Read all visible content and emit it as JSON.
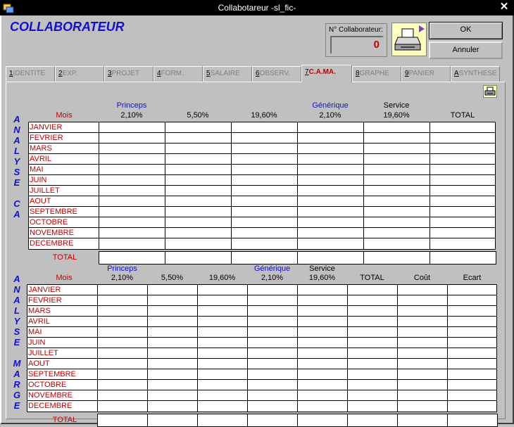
{
  "window": {
    "title": "Collabotareur -sl_fic-",
    "close_label": "✕"
  },
  "heading": "COLLABORATEUR",
  "collaborator": {
    "label": "N° Collaborateur:",
    "value": "0"
  },
  "buttons": {
    "ok": "OK",
    "cancel": "Annuler"
  },
  "tabs": [
    {
      "num": "1",
      "label": "IDENTITE"
    },
    {
      "num": "2",
      "label": "EXP."
    },
    {
      "num": "3",
      "label": "PROJET"
    },
    {
      "num": "4",
      "label": "FORM."
    },
    {
      "num": "5",
      "label": "SALAIRE"
    },
    {
      "num": "6",
      "label": "OBSERV."
    },
    {
      "num": "7",
      "label": "C.A.MA."
    },
    {
      "num": "8",
      "label": "GRAPHE"
    },
    {
      "num": "9",
      "label": "PANIER"
    },
    {
      "num": "A",
      "label": "SYNTHESE"
    }
  ],
  "active_tab": 6,
  "section1": {
    "vertical_label": [
      "A",
      "N",
      "A",
      "L",
      "Y",
      "S",
      "E",
      "",
      "C",
      "A"
    ],
    "month_header": "Mois",
    "columns": [
      {
        "top": "Princeps",
        "bottom": "2,10%"
      },
      {
        "top": "",
        "bottom": "5,50%"
      },
      {
        "top": "",
        "bottom": "19,60%"
      },
      {
        "top": "Générique",
        "bottom": "2,10%"
      },
      {
        "top": "Service",
        "bottom": "19,60%"
      },
      {
        "top": "",
        "bottom": "TOTAL"
      }
    ],
    "total_label": "TOTAL"
  },
  "section2": {
    "vertical_label": [
      "A",
      "N",
      "A",
      "L",
      "Y",
      "S",
      "E",
      "",
      "M",
      "A",
      "R",
      "G",
      "E"
    ],
    "month_header": "Mois",
    "columns": [
      {
        "top": "Princeps",
        "bottom": "2,10%"
      },
      {
        "top": "",
        "bottom": "5,50%"
      },
      {
        "top": "",
        "bottom": "19,60%"
      },
      {
        "top": "Générique",
        "bottom": "2,10%"
      },
      {
        "top": "Service",
        "bottom": "19,60%"
      },
      {
        "top": "",
        "bottom": "TOTAL"
      },
      {
        "top": "",
        "bottom": "Coût"
      },
      {
        "top": "",
        "bottom": "Ecart"
      }
    ],
    "total_label": "TOTAL"
  },
  "months": [
    "JANVIER",
    "FEVRIER",
    "MARS",
    "AVRIL",
    "MAI",
    "JUIN",
    "JUILLET",
    "AOUT",
    "SEPTEMBRE",
    "OCTOBRE",
    "NOVEMBRE",
    "DECEMBRE"
  ],
  "colors": {
    "heading": "#1010d0",
    "month_text": "#c00000",
    "counter_value": "#c00000",
    "active_tab": "#c00000"
  },
  "icons": {
    "app": "app-icon",
    "print_big": "printer-icon",
    "print_small": "printer-icon"
  }
}
